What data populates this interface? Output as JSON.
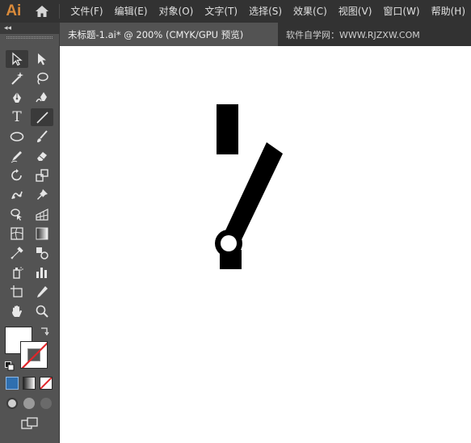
{
  "app": {
    "logo": "Ai"
  },
  "menu": {
    "items": [
      "文件(F)",
      "编辑(E)",
      "对象(O)",
      "文字(T)",
      "选择(S)",
      "效果(C)",
      "视图(V)",
      "窗口(W)",
      "帮助(H)"
    ]
  },
  "tabs": {
    "document": "未标题-1.ai* @ 200% (CMYK/GPU 预览)",
    "watermark": "软件自学网：WWW.RJZXW.COM"
  },
  "toolbar": {
    "collapse": "◂◂",
    "type_tool_glyph": "T",
    "tools": [
      "selection-tool",
      "direct-selection-tool",
      "magic-wand-tool",
      "lasso-tool",
      "pen-tool",
      "curvature-tool",
      "type-tool",
      "line-segment-tool",
      "ellipse-tool",
      "paintbrush-tool",
      "shaper-tool",
      "eraser-tool",
      "rotate-tool",
      "scale-tool",
      "puppet-warp-tool",
      "pin-tool",
      "shape-builder-tool",
      "perspective-grid-tool",
      "mesh-tool",
      "gradient-tool",
      "eyedropper-tool",
      "blend-tool",
      "symbol-sprayer-tool",
      "column-graph-tool",
      "artboard-tool",
      "slice-tool",
      "hand-tool",
      "zoom-tool"
    ],
    "active_tools": [
      "selection-tool",
      "line-segment-tool"
    ],
    "fill_color": "#ffffff",
    "stroke_color": "none"
  },
  "colors": {
    "accent": "#d98a3a",
    "ui_dark": "#323232",
    "ui_mid": "#535353",
    "canvas": "#ffffff",
    "artwork": "#000000"
  }
}
